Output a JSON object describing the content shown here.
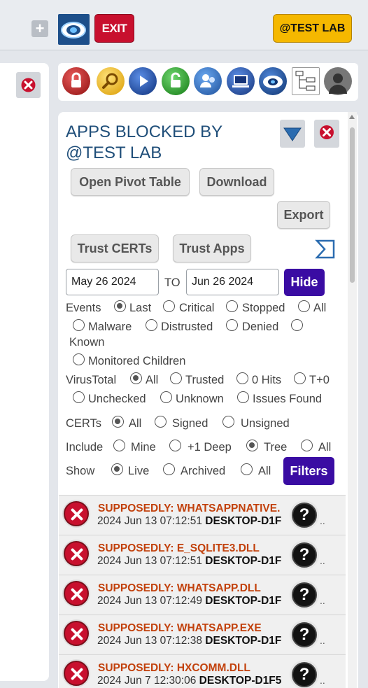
{
  "topbar": {
    "add_symbol": "+",
    "exit_label": "EXIT",
    "testlab_label": "@TEST LAB"
  },
  "panel": {
    "title_line1": "APPS BLOCKED BY",
    "title_line2": "@TEST LAB",
    "open_pivot": "Open Pivot Table",
    "download": "Download",
    "export": "Export",
    "trust_certs": "Trust CERTs",
    "trust_apps": "Trust Apps",
    "date_from": "May 26 2024",
    "to": "TO",
    "date_to": "Jun 26 2024",
    "hide": "Hide",
    "filters": "Filters"
  },
  "events": {
    "label": "Events",
    "options": [
      "Last",
      "Critical",
      "Stopped",
      "All",
      "Malware",
      "Distrusted",
      "Denied",
      "Known",
      "Monitored Children"
    ],
    "selected": "Last"
  },
  "virustotal": {
    "label": "VirusTotal",
    "options": [
      "All",
      "Trusted",
      "0 Hits",
      "T+0",
      "Unchecked",
      "Unknown",
      "Issues Found"
    ],
    "selected": "All"
  },
  "certs": {
    "label": "CERTs",
    "options": [
      "All",
      "Signed",
      "Unsigned"
    ],
    "selected": "All"
  },
  "include": {
    "label": "Include",
    "options": [
      "Mine",
      "+1 Deep",
      "Tree",
      "All"
    ],
    "selected": "Tree"
  },
  "show": {
    "label": "Show",
    "options": [
      "Live",
      "Archived",
      "All"
    ],
    "selected": "Live"
  },
  "rows": [
    {
      "title": "SUPPOSEDLY: WHATSAPPNATIVE.",
      "date": "2024 Jun 13 07:12:51",
      "host": "DESKTOP-D1F",
      "more": ".."
    },
    {
      "title": "SUPPOSEDLY: E_SQLITE3.DLL",
      "date": "2024 Jun 13 07:12:51",
      "host": "DESKTOP-D1F",
      "more": ".."
    },
    {
      "title": "SUPPOSEDLY: WHATSAPP.DLL",
      "date": "2024 Jun 13 07:12:49",
      "host": "DESKTOP-D1F",
      "more": ".."
    },
    {
      "title": "SUPPOSEDLY: WHATSAPP.EXE",
      "date": "2024 Jun 13 07:12:38",
      "host": "DESKTOP-D1F",
      "more": ".."
    },
    {
      "title": "SUPPOSEDLY: HXCOMM.DLL",
      "date": "2024 Jun 7 12:30:06",
      "host": "DESKTOP-D1F5",
      "more": ".."
    }
  ],
  "colors": {
    "accent": "#3a0ca3",
    "title": "#1f4e79",
    "alert": "#c2410c",
    "exit": "#c8102e",
    "testlab": "#f5b800"
  },
  "icons": [
    "lock-red-icon",
    "magnifier-icon",
    "play-icon",
    "lock-green-icon",
    "users-icon",
    "computer-icon",
    "cloud-eye-icon",
    "org-chart-icon",
    "user-avatar-icon"
  ]
}
